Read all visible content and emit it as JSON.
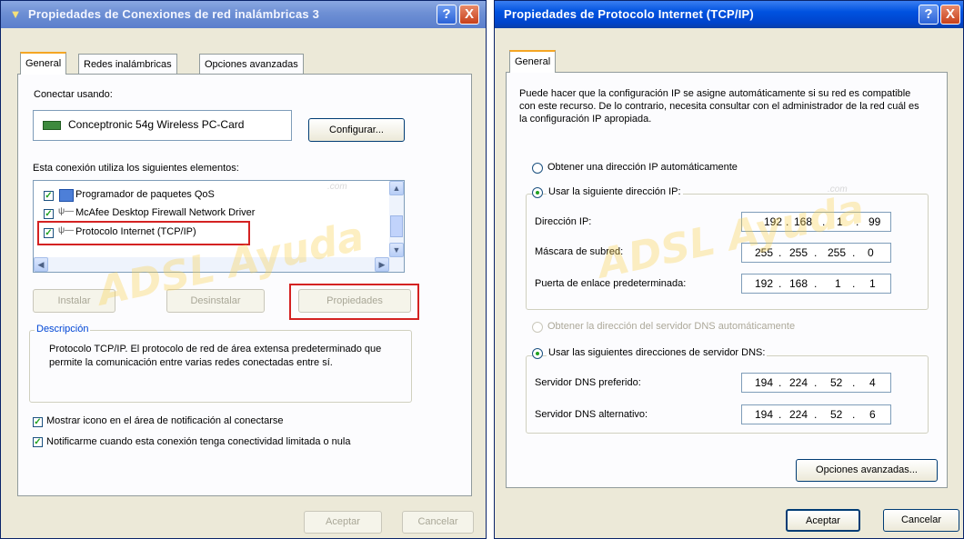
{
  "left_window": {
    "title": "Propiedades de Conexiones de red inalámbricas 3",
    "help_label": "?",
    "close_label": "X",
    "tabs": [
      "General",
      "Redes inalámbricas",
      "Opciones avanzadas"
    ],
    "connect_using_label": "Conectar usando:",
    "adapter_name": "Conceptronic 54g Wireless PC-Card",
    "configure_label": "Configurar...",
    "elements_label": "Esta conexión utiliza los siguientes elementos:",
    "elements": [
      {
        "label": "Programador de paquetes QoS",
        "checked": true
      },
      {
        "label": "McAfee Desktop Firewall Network Driver",
        "checked": true
      },
      {
        "label": "Protocolo Internet (TCP/IP)",
        "checked": true
      }
    ],
    "install_label": "Instalar",
    "uninstall_label": "Desinstalar",
    "properties_label": "Propiedades",
    "description_title": "Descripción",
    "description_text": "Protocolo TCP/IP. El protocolo de red de área extensa predeterminado que permite la comunicación entre varias redes conectadas entre sí.",
    "show_icon_label": "Mostrar icono en el área de notificación al conectarse",
    "notify_label": "Notificarme cuando esta conexión tenga conectividad limitada o nula",
    "ok_label": "Aceptar",
    "cancel_label": "Cancelar"
  },
  "right_window": {
    "title": "Propiedades de Protocolo Internet (TCP/IP)",
    "help_label": "?",
    "close_label": "X",
    "tab": "General",
    "info_text": "Puede hacer que la configuración IP se asigne automáticamente si su red es compatible con este recurso. De lo contrario, necesita consultar con el administrador de la red cuál es la configuración IP apropiada.",
    "auto_ip_label": "Obtener una dirección IP automáticamente",
    "manual_ip_label": "Usar la siguiente dirección IP:",
    "ip_label": "Dirección IP:",
    "ip_value": [
      "192",
      "168",
      "1",
      "99"
    ],
    "mask_label": "Máscara de subred:",
    "mask_value": [
      "255",
      "255",
      "255",
      "0"
    ],
    "gateway_label": "Puerta de enlace predeterminada:",
    "gateway_value": [
      "192",
      "168",
      "1",
      "1"
    ],
    "auto_dns_label": "Obtener la dirección del servidor DNS automáticamente",
    "manual_dns_label": "Usar las siguientes direcciones de servidor DNS:",
    "dns1_label": "Servidor DNS preferido:",
    "dns1_value": [
      "194",
      "224",
      "52",
      "4"
    ],
    "dns2_label": "Servidor DNS alternativo:",
    "dns2_value": [
      "194",
      "224",
      "52",
      "6"
    ],
    "advanced_label": "Opciones avanzadas...",
    "ok_label": "Aceptar",
    "cancel_label": "Cancelar"
  },
  "watermark": {
    "brand": "ADSL Ayuda",
    "suffix": ".com"
  },
  "colors": {
    "highlight": "#d42222",
    "xp_blue": "#0052e0",
    "check_green": "#21a121"
  }
}
